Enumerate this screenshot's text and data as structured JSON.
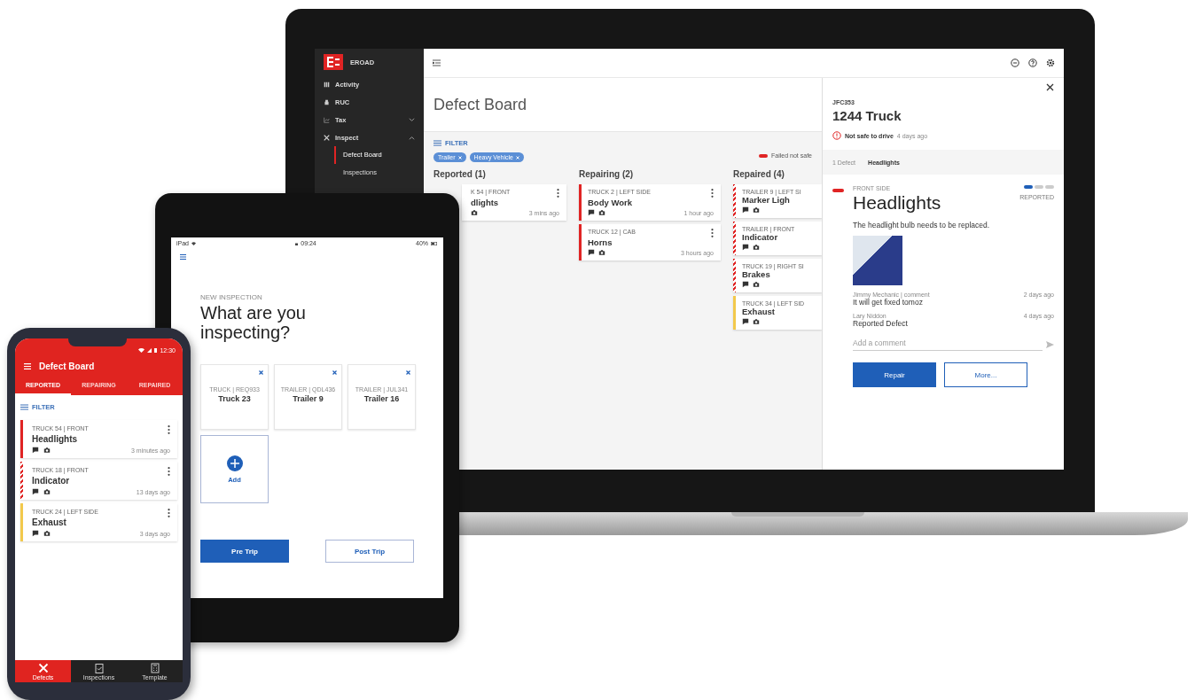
{
  "laptop": {
    "sidebar": {
      "brand": "EROAD",
      "items": [
        {
          "label": "Activity",
          "kind": "link"
        },
        {
          "label": "RUC",
          "kind": "link"
        },
        {
          "label": "Tax",
          "kind": "group",
          "expanded": false
        },
        {
          "label": "Inspect",
          "kind": "group",
          "expanded": true,
          "children": [
            {
              "label": "Defect Board",
              "selected": true
            },
            {
              "label": "Inspections",
              "selected": false
            }
          ]
        }
      ]
    },
    "title": "Defect Board",
    "filter_label": "FILTER",
    "filters": [
      "Trailer",
      "Heavy Vehicle"
    ],
    "legend": "Failed not safe",
    "columns": [
      {
        "title": "Reported (1)",
        "cards": [
          {
            "subtitle": "K 54 | FRONT",
            "title": "dlights",
            "time": "3 mins ago",
            "menu": true,
            "comment_icon": false
          }
        ]
      },
      {
        "title": "Repairing (2)",
        "cards": [
          {
            "subtitle": "TRUCK 2 | LEFT SIDE",
            "title": "Body Work",
            "time": "1 hour ago",
            "kind": "unsafe",
            "menu": true,
            "comment_icon": true
          },
          {
            "subtitle": "TRUCK 12 | CAB",
            "title": "Horns",
            "time": "3 hours ago",
            "kind": "unsafe",
            "menu": true,
            "comment_icon": true
          }
        ]
      },
      {
        "title": "Repaired (4)",
        "cards": [
          {
            "subtitle": "TRAILER 9 | LEFT SI",
            "title": "Marker Ligh",
            "kind": "hazard",
            "menu": false,
            "comment_icon": true
          },
          {
            "subtitle": "TRAILER | FRONT",
            "title": "Indicator",
            "kind": "hazard",
            "menu": false,
            "comment_icon": true
          },
          {
            "subtitle": "TRUCK 19 | RIGHT SI",
            "title": "Brakes",
            "kind": "hazard",
            "menu": false,
            "comment_icon": true
          },
          {
            "subtitle": "TRUCK 34 | LEFT SID",
            "title": "Exhaust",
            "kind": "minor",
            "menu": false,
            "comment_icon": true
          }
        ]
      }
    ],
    "detail": {
      "code": "JFC353",
      "vehicle": "1244 Truck",
      "alert": "Not safe to drive",
      "alert_time": "4 days ago",
      "crumbs": [
        {
          "label": "1 Defect",
          "selected": false
        },
        {
          "label": "Headlights",
          "selected": true
        }
      ],
      "marker": {
        "kind": "unsafe"
      },
      "location": "FRONT SIDE",
      "defect": "Headlights",
      "steps": [
        {
          "done": true
        },
        {
          "done": false
        },
        {
          "done": false
        }
      ],
      "status": "REPORTED",
      "description": "The headlight bulb needs to be replaced.",
      "comments": [
        {
          "author": "Jimmy Mechanic | comment",
          "time": "2 days ago",
          "text": "It will get fixed tomoz"
        },
        {
          "author": "Lary Niddon",
          "time": "4 days ago",
          "text": "Reported Defect"
        }
      ],
      "comment_placeholder": "Add a comment",
      "buttons": [
        {
          "label": "Repair",
          "primary": true
        },
        {
          "label": "More...",
          "primary": false
        }
      ]
    }
  },
  "tablet": {
    "carrier": "iPad",
    "time": "09:24",
    "battery": "40%",
    "overline": "NEW INSPECTION",
    "heading": "What are you inspecting?",
    "vehicles": [
      {
        "type": "TRUCK | REQ933",
        "name": "Truck 23"
      },
      {
        "type": "TRAILER | QDL436",
        "name": "Trailer 9"
      },
      {
        "type": "TRAILER | JUL341",
        "name": "Trailer 16"
      }
    ],
    "add_label": "Add",
    "buttons": [
      {
        "label": "Pre Trip",
        "primary": true
      },
      {
        "label": "Post Trip",
        "primary": false
      }
    ]
  },
  "phone": {
    "time": "12:30",
    "title": "Defect Board",
    "tabs": [
      {
        "label": "REPORTED",
        "selected": true
      },
      {
        "label": "REPAIRING",
        "selected": false
      },
      {
        "label": "REPAIRED",
        "selected": false
      }
    ],
    "filter_label": "FILTER",
    "cards": [
      {
        "subtitle": "TRUCK 54 | FRONT",
        "title": "Headlights",
        "time": "3 minutes ago",
        "kind": "unsafe"
      },
      {
        "subtitle": "TRUCK 18 | FRONT",
        "title": "Indicator",
        "time": "13 days ago",
        "kind": "hazard"
      },
      {
        "subtitle": "TRUCK 24 | LEFT SIDE",
        "title": "Exhaust",
        "time": "3 days ago",
        "kind": "minor"
      }
    ],
    "nav": [
      {
        "label": "Defects",
        "selected": true
      },
      {
        "label": "Inspections",
        "selected": false
      },
      {
        "label": "Template",
        "selected": false
      }
    ]
  }
}
